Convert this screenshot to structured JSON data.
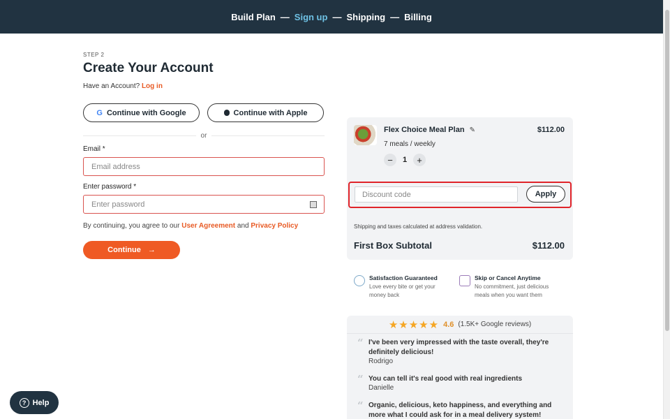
{
  "nav": {
    "steps": [
      "Build Plan",
      "Sign up",
      "Shipping",
      "Billing"
    ],
    "separator": "—",
    "active_color": "#6ec1e4",
    "background": "#213341"
  },
  "signup": {
    "step_label": "STEP 2",
    "title": "Create Your Account",
    "have_account": "Have an Account?",
    "login_link": "Log in",
    "google_label": "Continue with Google",
    "apple_label": "Continue with Apple",
    "google_glyph": "G",
    "or_text": "or",
    "email_label": "Email *",
    "email_placeholder": "Email address",
    "password_label": "Enter password *",
    "password_placeholder": "Enter password",
    "consent_prefix": "By continuing, you agree to our",
    "user_agreement": "User Agreement",
    "and_text": "and",
    "privacy_policy": "Privacy Policy",
    "continue_label": "Continue",
    "continue_arrow": "→",
    "accent": "#ef5a24"
  },
  "order": {
    "plan_name": "Flex Choice Meal Plan",
    "pencil_glyph": "✎",
    "plan_price": "$112.00",
    "plan_sub": "7 meals / weekly",
    "minus": "−",
    "quantity": "1",
    "plus": "+",
    "discount_placeholder": "Discount code",
    "apply_label": "Apply",
    "shipping_note": "Shipping and taxes calculated at address validation.",
    "subtotal_label": "First Box Subtotal",
    "subtotal_value": "$112.00",
    "highlight_color": "#e0242a"
  },
  "guarantees": [
    {
      "title": "Satisfaction Guaranteed",
      "desc": "Love every bite or get your money back",
      "icon": "badge-icon"
    },
    {
      "title": "Skip or Cancel Anytime",
      "desc": "No commitment, just delicious meals when you want them",
      "icon": "calendar-icon"
    }
  ],
  "reviews": {
    "stars": "★★★★★",
    "star_rating": 4.6,
    "rating": "4.6",
    "count": "(1.5K+ Google reviews)",
    "quote_glyph": "“",
    "items": [
      {
        "text": "I've been very impressed with the taste overall, they're definitely delicious!",
        "author": "Rodrigo"
      },
      {
        "text": "You can tell it's real good with real ingredients",
        "author": "Danielle"
      },
      {
        "text": "Organic, delicious, keto happiness, and everything and more what I could ask for in a meal delivery system!",
        "author": ""
      }
    ]
  },
  "help": {
    "label": "Help",
    "glyph": "?"
  }
}
